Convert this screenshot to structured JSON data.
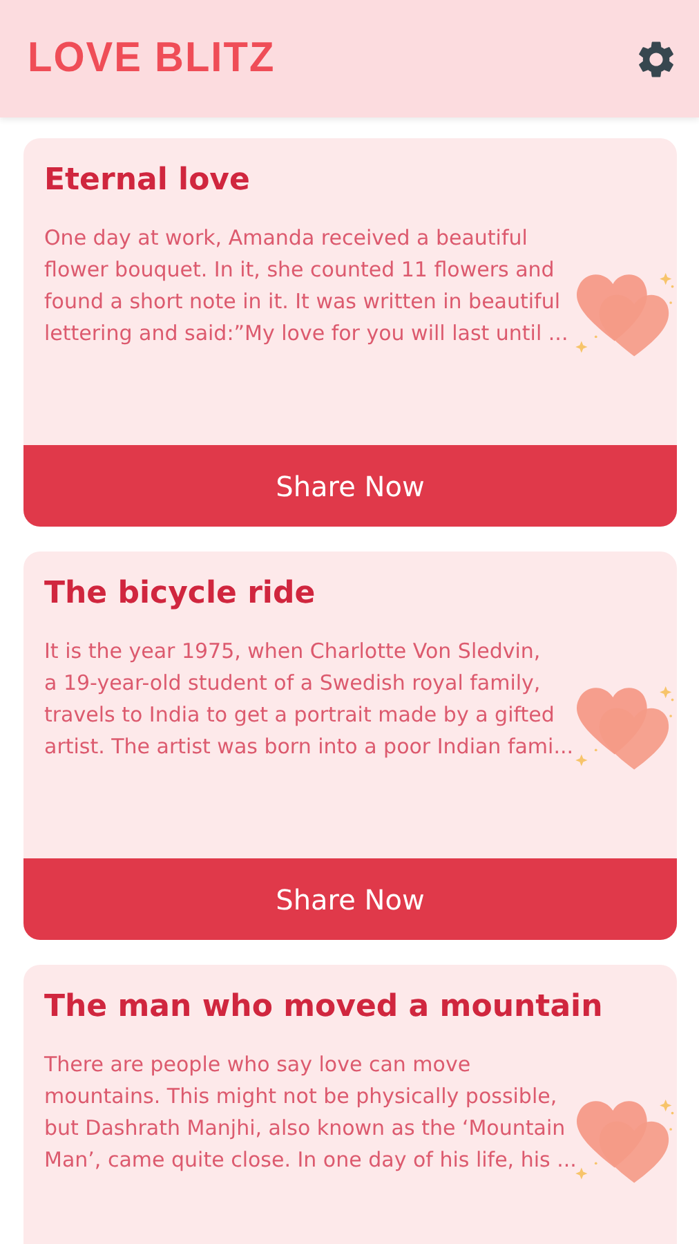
{
  "header": {
    "logo": "LOVE BLITZ"
  },
  "stories": [
    {
      "title": "Eternal love",
      "lines": [
        "One day at work, Amanda received a beautiful",
        "flower bouquet. In it, she counted 11 flowers and",
        "found a short note in it. It was written in beautiful",
        "lettering and said:”My love for you will last until ..."
      ],
      "button": "Share Now"
    },
    {
      "title": "The bicycle ride",
      "lines": [
        "It is the year 1975, when Charlotte Von Sledvin,",
        "a 19-year-old student of a Swedish royal family,",
        "travels to India to get a portrait made by a gifted",
        "artist. The artist was born into a poor Indian fami..."
      ],
      "button": "Share Now"
    },
    {
      "title": "The man who moved a mountain",
      "lines": [
        "There are people who say love can move",
        "mountains. This might not be physically possible,",
        "but Dashrath Manjhi, also known as the ‘Mountain",
        "Man’, came quite close. In one day of his life, his ..."
      ]
    }
  ]
}
